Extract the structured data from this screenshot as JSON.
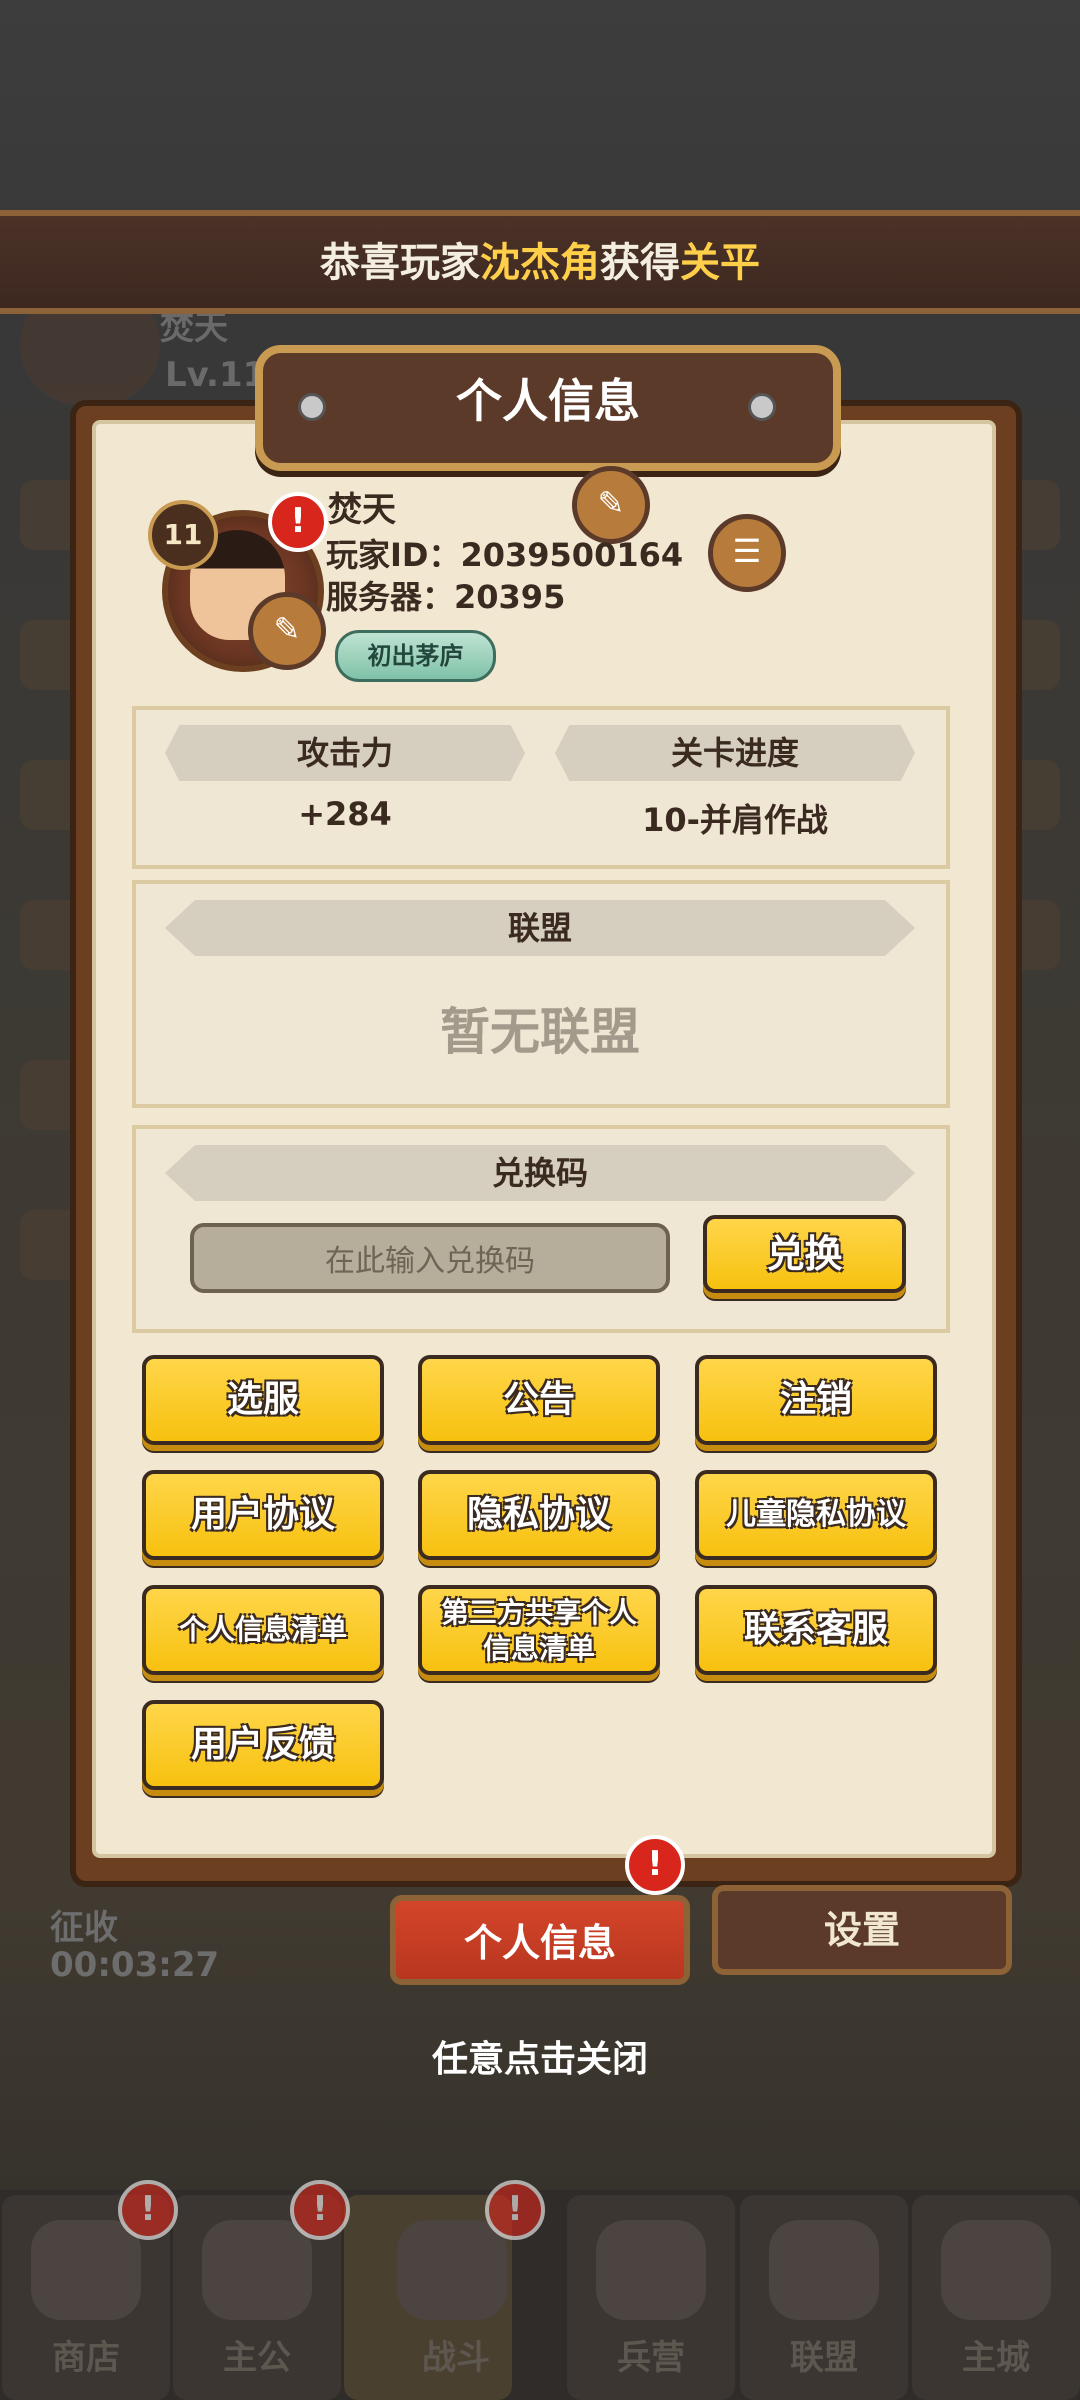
{
  "banner": {
    "prefix": "恭喜玩家",
    "player": "沈杰角",
    "mid": "获得",
    "reward": "关平"
  },
  "background": {
    "name": "焚天",
    "level": "Lv.11",
    "collect": "征收",
    "timer": "00:03:27"
  },
  "dialog": {
    "title": "个人信息",
    "profile": {
      "level": "11",
      "name": "焚天",
      "player_id": "玩家ID：2039500164",
      "server": "服务器：20395",
      "title_badge": "初出茅庐"
    },
    "stats": {
      "attack_label": "攻击力",
      "attack_value": "+284",
      "stage_label": "关卡进度",
      "stage_value": "10-并肩作战"
    },
    "alliance": {
      "label": "联盟",
      "value": "暂无联盟"
    },
    "redeem": {
      "label": "兑换码",
      "placeholder": "在此输入兑换码",
      "button": "兑换"
    },
    "buttons": [
      "选服",
      "公告",
      "注销",
      "用户协议",
      "隐私协议",
      "儿童隐私协议",
      "个人信息清单",
      "第三方共享个人信息清单",
      "联系客服",
      "用户反馈"
    ],
    "tabs": {
      "active": "个人信息",
      "other": "设置"
    },
    "close_hint": "任意点击关闭"
  },
  "bottom_nav": [
    "商店",
    "主公",
    "战斗",
    "兵营",
    "联盟",
    "主城"
  ],
  "colors": {
    "accent": "#f7c10f",
    "panel": "#f2e8d2",
    "alert": "#d9261c"
  }
}
